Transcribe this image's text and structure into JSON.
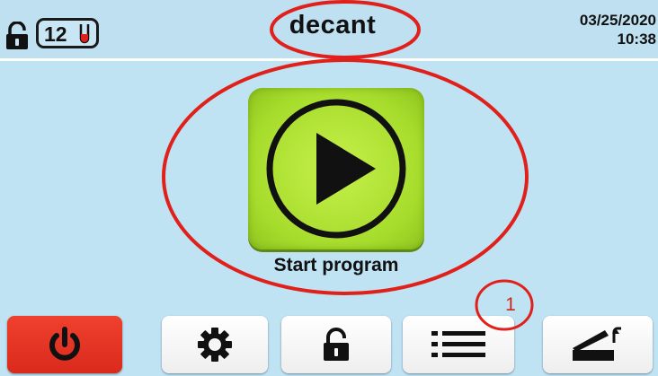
{
  "header": {
    "tube_count": "12",
    "title": "decant",
    "date": "03/25/2020",
    "time": "10:38",
    "lock_icon": "unlocked-padlock-icon",
    "tube_icon": "test-tube-icon"
  },
  "main": {
    "start_label": "Start program",
    "play_icon": "play-circle-icon",
    "button_color": "#b4e43a"
  },
  "toolbar": {
    "buttons": [
      {
        "icon": "power-icon",
        "color": "#e33422"
      },
      {
        "icon": "gear-icon"
      },
      {
        "icon": "unlocked-padlock-icon"
      },
      {
        "icon": "list-menu-icon"
      },
      {
        "icon": "lid-open-icon"
      }
    ]
  },
  "annotation": {
    "marker_label": "1",
    "color": "#e0201a"
  }
}
